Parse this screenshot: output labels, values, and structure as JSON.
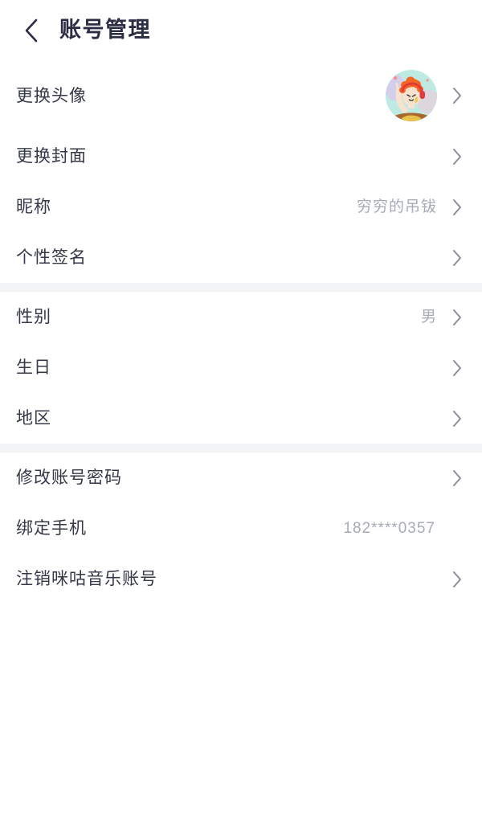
{
  "header": {
    "back_icon": "chevron-left-icon",
    "title": "账号管理"
  },
  "colors": {
    "background": "#ffffff",
    "section_divider": "#f3f4f6",
    "label_text": "#343847",
    "value_text": "#a7abb8",
    "chevron": "#8a8e9c",
    "title_text": "#2b2d42",
    "avatar_background": "#bfe9e3",
    "avatar_hair": "#f4661f",
    "avatar_headphones": "#e03a3a",
    "avatar_skin": "#f7e2cf",
    "avatar_shirt": "#e8c24a"
  },
  "sections": [
    {
      "name": "profile-media",
      "rows": [
        {
          "name": "change-avatar",
          "label": "更换头像",
          "value": "",
          "avatar": true,
          "avatar_icon": "user-avatar-image",
          "chevron": true,
          "tall": true
        },
        {
          "name": "change-cover",
          "label": "更换封面",
          "value": "",
          "avatar": false,
          "chevron": true,
          "tall": false
        },
        {
          "name": "nickname",
          "label": "昵称",
          "value": "穷穷的吊钹",
          "avatar": false,
          "chevron": true,
          "tall": false
        },
        {
          "name": "signature",
          "label": "个性签名",
          "value": "",
          "avatar": false,
          "chevron": true,
          "tall": false
        }
      ]
    },
    {
      "name": "personal-info",
      "rows": [
        {
          "name": "gender",
          "label": "性别",
          "value": "男",
          "avatar": false,
          "chevron": true,
          "tall": false
        },
        {
          "name": "birthday",
          "label": "生日",
          "value": "",
          "avatar": false,
          "chevron": true,
          "tall": false
        },
        {
          "name": "region",
          "label": "地区",
          "value": "",
          "avatar": false,
          "chevron": true,
          "tall": false
        }
      ]
    },
    {
      "name": "account-security",
      "rows": [
        {
          "name": "change-password",
          "label": "修改账号密码",
          "value": "",
          "avatar": false,
          "chevron": true,
          "tall": false
        },
        {
          "name": "bound-phone",
          "label": "绑定手机",
          "value": "182****0357",
          "avatar": false,
          "chevron": false,
          "tall": false
        },
        {
          "name": "delete-account",
          "label": "注销咪咕音乐账号",
          "value": "",
          "avatar": false,
          "chevron": true,
          "tall": false
        }
      ]
    }
  ]
}
